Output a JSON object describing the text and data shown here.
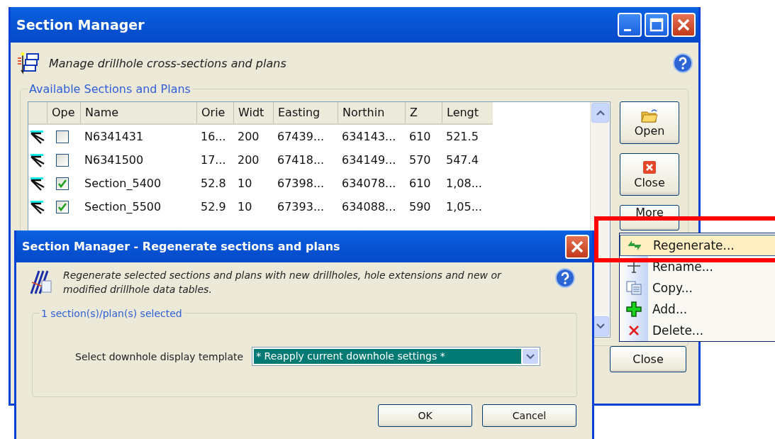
{
  "main_window": {
    "title": "Section Manager",
    "header_text": "Manage drillhole cross-sections and plans",
    "group_label": "Available Sections and Plans",
    "table": {
      "check_column": "Ope",
      "columns": [
        "Name",
        "Orie",
        "Widt",
        "Easting",
        "Northin",
        "Z",
        "Lengt"
      ],
      "rows": [
        {
          "checked": false,
          "cells": [
            "N6341431",
            "16...",
            "200",
            "67439...",
            "634143...",
            "610",
            "521.5"
          ]
        },
        {
          "checked": false,
          "cells": [
            "N6341500",
            "17...",
            "200",
            "67418...",
            "634149...",
            "570",
            "547.4"
          ]
        },
        {
          "checked": true,
          "cells": [
            "Section_5400",
            "52.8",
            "10",
            "67398...",
            "634078...",
            "610",
            "1,08..."
          ]
        },
        {
          "checked": true,
          "cells": [
            "Section_5500",
            "52.9",
            "10",
            "67393...",
            "634088...",
            "590",
            "1,05..."
          ]
        }
      ]
    },
    "side_buttons": [
      {
        "kind": "open",
        "label": "Open"
      },
      {
        "kind": "close",
        "label": "Close"
      },
      {
        "kind": "more",
        "label": "More"
      }
    ],
    "close_button": "Close"
  },
  "dialog": {
    "title": "Section Manager - Regenerate sections and plans",
    "description": "Regenerate selected sections and plans with new drillholes, hole extensions and new or modified drillhole data tables.",
    "group_label": "1 section(s)/plan(s) selected",
    "template_label": "Select downhole display template",
    "template_value": "* Reapply current downhole settings *",
    "buttons": [
      "OK",
      "Cancel"
    ]
  },
  "menu": {
    "items": [
      {
        "kind": "regenerate",
        "label": "Regenerate...",
        "selected": true
      },
      {
        "kind": "rename",
        "label": "Rename...",
        "selected": false
      },
      {
        "kind": "copy",
        "label": "Copy...",
        "selected": false
      },
      {
        "kind": "add",
        "label": "Add...",
        "selected": false
      },
      {
        "kind": "delete",
        "label": "Delete...",
        "selected": false
      }
    ]
  }
}
